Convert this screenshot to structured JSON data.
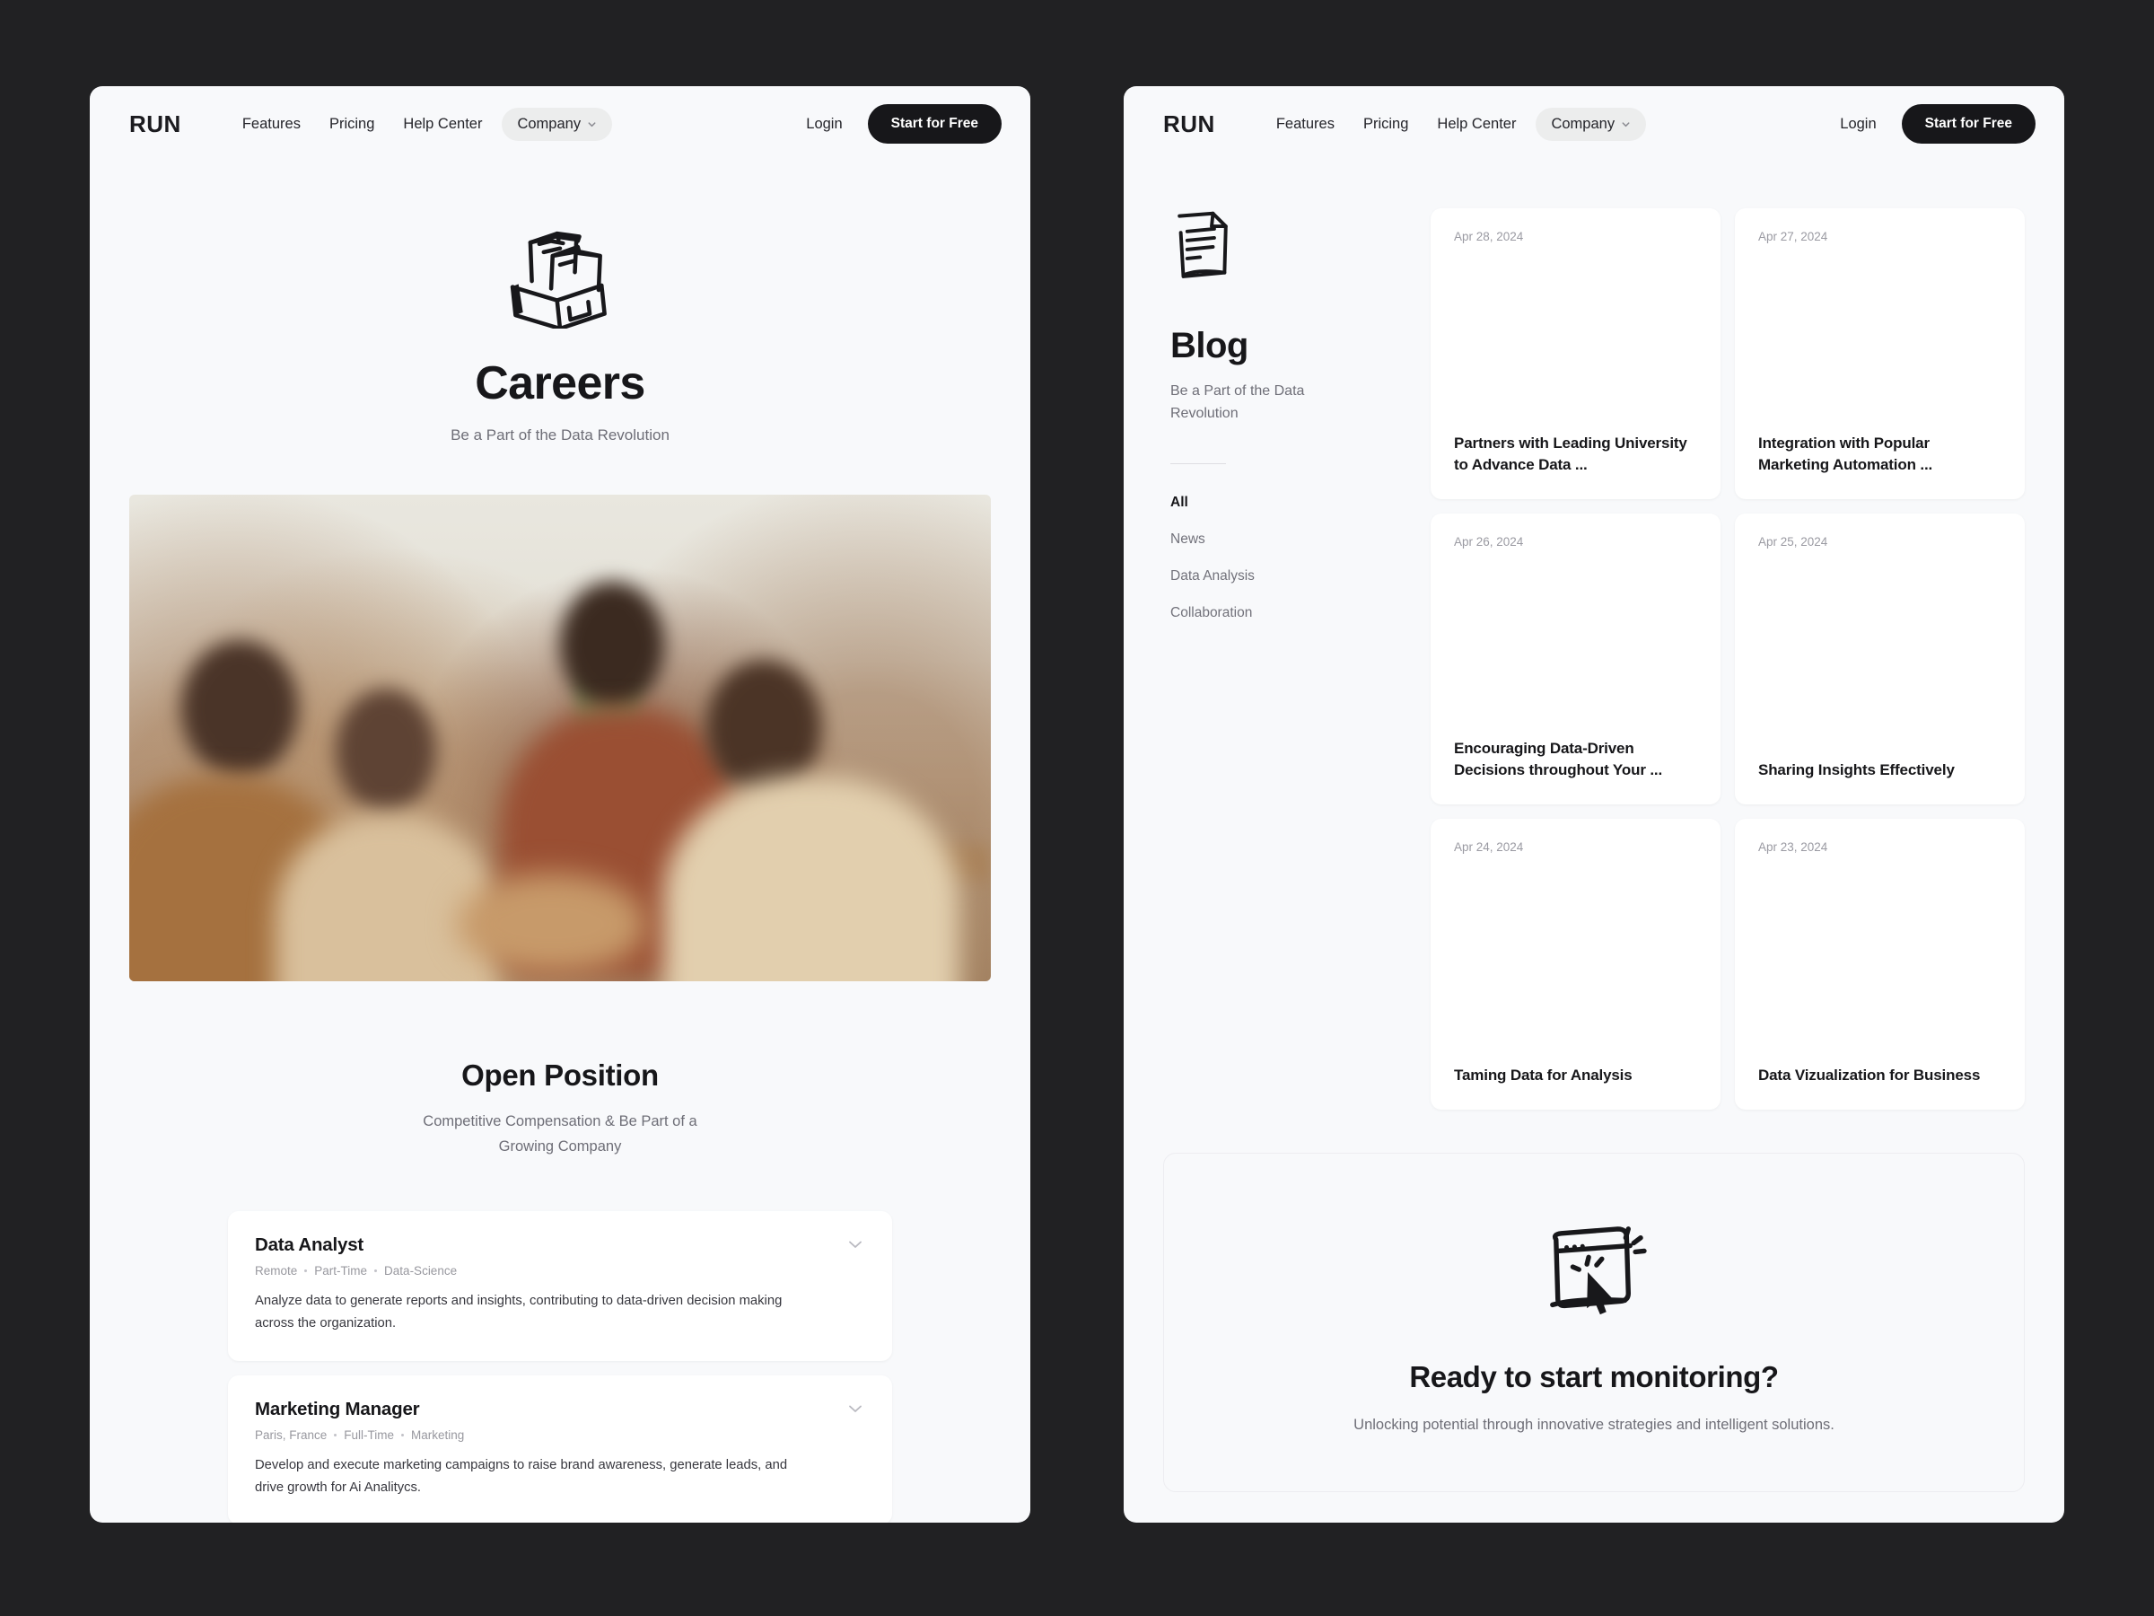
{
  "nav": {
    "brand": "RUN",
    "links": [
      "Features",
      "Pricing",
      "Help Center"
    ],
    "company_label": "Company",
    "login_label": "Login",
    "cta_label": "Start for Free"
  },
  "careers": {
    "icon_name": "file-box-sketch-icon",
    "title": "Careers",
    "subtitle": "Be a Part of the Data Revolution",
    "photo_alt": "business team shaking hands in office",
    "section_title": "Open Position",
    "section_subtitle": "Competitive Compensation & Be Part of a Growing Company",
    "jobs": [
      {
        "title": "Data Analyst",
        "meta": [
          "Remote",
          "Part-Time",
          "Data-Science"
        ],
        "description": "Analyze data to generate reports and insights, contributing to data-driven decision making across the organization."
      },
      {
        "title": "Marketing Manager",
        "meta": [
          "Paris, France",
          "Full-Time",
          "Marketing"
        ],
        "description": "Develop and execute marketing campaigns to raise brand awareness, generate leads, and drive growth for Ai Analitycs."
      }
    ]
  },
  "blog": {
    "icon_name": "document-sketch-icon",
    "title": "Blog",
    "subtitle": "Be a Part of the Data Revolution",
    "categories": [
      {
        "label": "All",
        "active": true
      },
      {
        "label": "News",
        "active": false
      },
      {
        "label": "Data Analysis",
        "active": false
      },
      {
        "label": "Collaboration",
        "active": false
      }
    ],
    "posts": [
      {
        "date": "Apr 28, 2024",
        "title": "Partners with Leading University to Advance Data ..."
      },
      {
        "date": "Apr 27, 2024",
        "title": "Integration with Popular Marketing Automation ..."
      },
      {
        "date": "Apr 26, 2024",
        "title": "Encouraging Data-Driven Decisions throughout Your ..."
      },
      {
        "date": "Apr 25, 2024",
        "title": "Sharing Insights Effectively"
      },
      {
        "date": "Apr 24, 2024",
        "title": "Taming Data for Analysis"
      },
      {
        "date": "Apr 23, 2024",
        "title": "Data Vizualization for Business"
      }
    ],
    "cta": {
      "icon_name": "browser-click-sketch-icon",
      "title": "Ready to start monitoring?",
      "subtitle": "Unlocking potential through innovative strategies and intelligent solutions."
    }
  },
  "colors": {
    "page_bg": "#212123",
    "panel_bg": "#f8f9fb",
    "card_bg": "#ffffff",
    "ink": "#17171a",
    "muted": "#6e6e77",
    "accent_dark": "#17171a"
  }
}
